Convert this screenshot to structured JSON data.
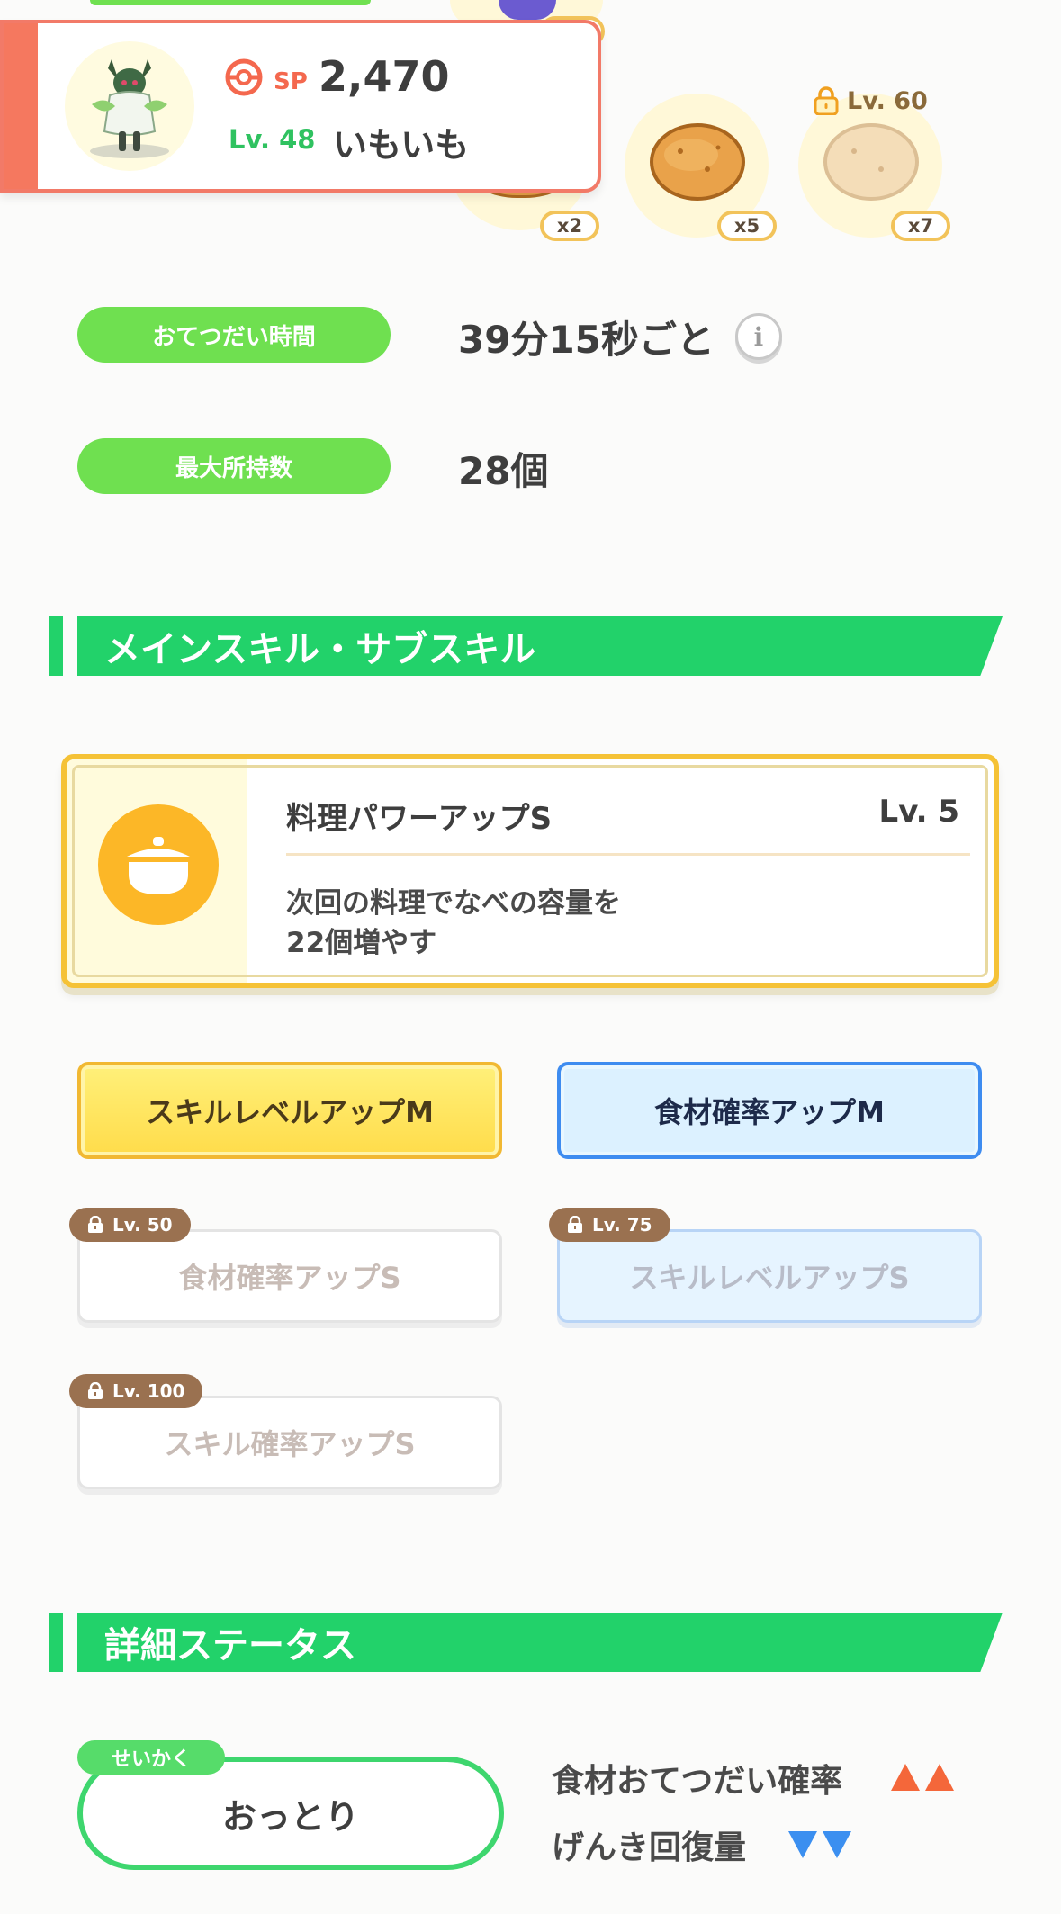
{
  "header": {
    "sp_label": "SP",
    "sp_value": "2,470",
    "level": "Lv. 48",
    "nickname": "いもいも"
  },
  "ingredients": {
    "counts": [
      "x2",
      "x5",
      "x7"
    ],
    "lock_level": "Lv. 60"
  },
  "info": {
    "help_time_label": "おてつだい時間",
    "help_time_value": "39分15秒ごと",
    "max_carry_label": "最大所持数",
    "max_carry_value": "28個"
  },
  "skills_section": {
    "title": "メインスキル・サブスキル",
    "main_skill": {
      "name": "料理パワーアップS",
      "level": "Lv. 5",
      "description_line1": "次回の料理でなべの容量を",
      "description_line2": "22個増やす"
    },
    "sub_skills": [
      {
        "label": "スキルレベルアップM",
        "style": "gold"
      },
      {
        "label": "食材確率アップM",
        "style": "blue"
      },
      {
        "label": "食材確率アップS",
        "style": "locked-white",
        "lock": "Lv. 50"
      },
      {
        "label": "スキルレベルアップS",
        "style": "locked-blue",
        "lock": "Lv. 75"
      },
      {
        "label": "スキル確率アップS",
        "style": "locked-white",
        "lock": "Lv. 100"
      }
    ]
  },
  "detail_section": {
    "title": "詳細ステータス",
    "nature_tag": "せいかく",
    "nature_value": "おっとり",
    "up_stat": "食材おてつだい確率",
    "down_stat": "げんき回復量"
  },
  "colors": {
    "accent_green": "#22d26a",
    "label_green": "#6fe050",
    "header_red": "#f5785f",
    "skill_gold": "#f5c236",
    "up_arrow": "#f4673a",
    "down_arrow": "#3b8ff0"
  }
}
